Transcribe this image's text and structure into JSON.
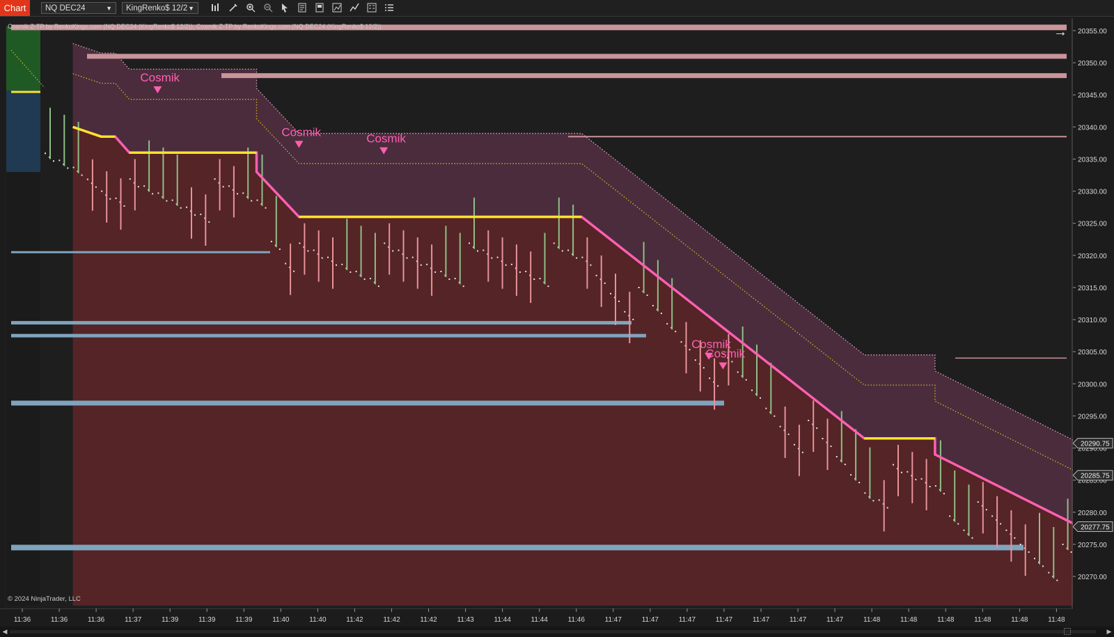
{
  "toolbar": {
    "tab_label": "Chart",
    "instrument": "NQ DEC24",
    "bar_type": "KingRenko$ 12/2",
    "icons": [
      "bars-type-icon",
      "draw-tool-icon",
      "zoom-in-icon",
      "zoom-out-icon",
      "pointer-icon",
      "data-series-icon",
      "templates-icon",
      "strategies-icon",
      "indicators-icon",
      "properties-icon",
      "list-icon"
    ]
  },
  "chart": {
    "indicator_label": "Cosmik Z-TP by RenkoKings.com (NQ DEC24 (KingRenko$ 12/2)), Cosmik Z-TP by RenkoKings.com (NQ DEC24 (KingRenko$ 12/2))",
    "copyright": "© 2024 NinjaTrader, LLC",
    "signal_label": "Cosmik",
    "colors": {
      "background": "#1e1e1e",
      "lower_fill": "#542426",
      "upper_fill": "#4b2c3d",
      "trail_line": "#ff5fb1",
      "signal_line": "#ffe22b",
      "band_dots": "#e2a6c7",
      "mid_dots": "#d7b41e",
      "resistance": "#c9949a",
      "support": "#7fa4be",
      "bull_wick": "#8fbf85",
      "bear_wick": "#e8939a"
    }
  },
  "chart_data": {
    "type": "candlestick",
    "instrument": "NQ DEC24",
    "x_tick_labels": [
      "11:36",
      "11:36",
      "11:36",
      "11:37",
      "11:39",
      "11:39",
      "11:39",
      "11:40",
      "11:40",
      "11:42",
      "11:42",
      "11:42",
      "11:43",
      "11:44",
      "11:44",
      "11:46",
      "11:47",
      "11:47",
      "11:47",
      "11:47",
      "11:47",
      "11:47",
      "11:47",
      "11:48",
      "11:48",
      "11:48",
      "11:48",
      "11:48",
      "11:48"
    ],
    "y_ticks": [
      20355.0,
      20350.0,
      20345.0,
      20340.0,
      20335.0,
      20330.0,
      20325.0,
      20320.0,
      20315.0,
      20310.0,
      20305.0,
      20300.0,
      20295.0,
      20290.0,
      20285.0,
      20280.0,
      20275.0,
      20270.0
    ],
    "y_tick_labels": [
      "20355.00",
      "20350.00",
      "20345.00",
      "20340.00",
      "20335.00",
      "20330.00",
      "20325.00",
      "20320.00",
      "20315.00",
      "20310.00",
      "20305.00",
      "20300.00",
      "20295.00",
      "20290.00",
      "20285.00",
      "20280.00",
      "20275.00",
      "20270.00"
    ],
    "ylim": [
      20267.5,
      20357.5
    ],
    "price_markers": [
      {
        "label": "20290.75",
        "value": 20290.75
      },
      {
        "label": "20285.75",
        "value": 20285.75
      },
      {
        "label": "20277.75",
        "value": 20277.75
      }
    ],
    "signals": [
      {
        "label": "Cosmik",
        "bar": 8,
        "price": 20346.0
      },
      {
        "label": "Cosmik",
        "bar": 18,
        "price": 20337.5
      },
      {
        "label": "Cosmik",
        "bar": 24,
        "price": 20336.5
      },
      {
        "label": "Cosmik",
        "bar": 47,
        "price": 20304.5
      },
      {
        "label": "Cosmik",
        "bar": 48,
        "price": 20303.0
      }
    ],
    "trail_line": [
      [
        2,
        20340
      ],
      [
        4,
        20338.5
      ],
      [
        5,
        20338.5
      ],
      [
        6,
        20336
      ],
      [
        15,
        20336
      ],
      [
        15,
        20333
      ],
      [
        18,
        20326
      ],
      [
        38,
        20326
      ],
      [
        58,
        20291.5
      ],
      [
        63,
        20291.5
      ],
      [
        63,
        20289
      ],
      [
        73,
        20278
      ]
    ],
    "horizontal_levels": [
      {
        "kind": "resistance",
        "price": 20355.5
      },
      {
        "kind": "resistance",
        "price": 20351.0
      },
      {
        "kind": "resistance",
        "price": 20348.0
      },
      {
        "kind": "resistance",
        "price": 20338.5
      },
      {
        "kind": "resistance",
        "price": 20304.0
      },
      {
        "kind": "support",
        "price": 20320.5
      },
      {
        "kind": "support",
        "price": 20309.5
      },
      {
        "kind": "support",
        "price": 20307.5
      },
      {
        "kind": "support",
        "price": 20297.0
      },
      {
        "kind": "support",
        "price": 20274.5
      }
    ]
  }
}
